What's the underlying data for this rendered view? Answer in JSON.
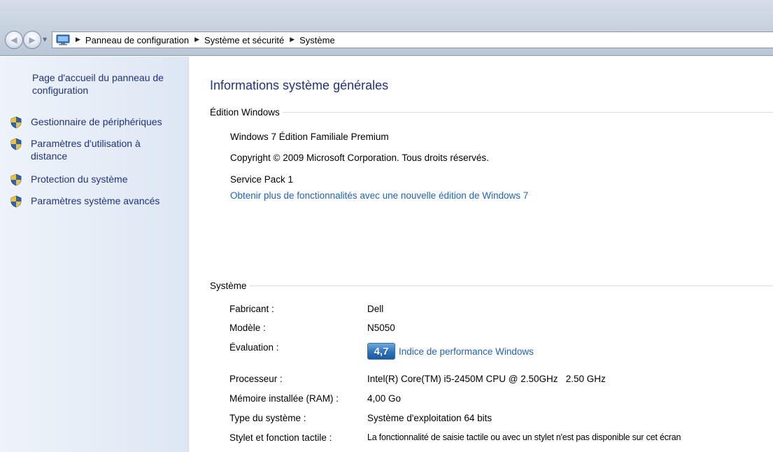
{
  "breadcrumb": {
    "items": [
      "Panneau de configuration",
      "Système et sécurité",
      "Système"
    ]
  },
  "sidebar": {
    "home_link": "Page d'accueil du panneau de configuration",
    "tasks": [
      {
        "label": "Gestionnaire de périphériques",
        "icon": "shield-icon"
      },
      {
        "label": "Paramètres d'utilisation à distance",
        "icon": "shield-icon"
      },
      {
        "label": "Protection du système",
        "icon": "shield-icon"
      },
      {
        "label": "Paramètres système avancés",
        "icon": "shield-icon"
      }
    ]
  },
  "main": {
    "title": "Informations système générales",
    "edition": {
      "header": "Édition Windows",
      "name": "Windows 7 Édition Familiale Premium",
      "copyright": "Copyright © 2009 Microsoft Corporation. Tous droits réservés.",
      "service_pack": "Service Pack 1",
      "upgrade_link": "Obtenir plus de fonctionnalités avec une nouvelle édition de Windows 7"
    },
    "system": {
      "header": "Système",
      "manufacturer_label": "Fabricant :",
      "manufacturer": "Dell",
      "model_label": "Modèle :",
      "model": "N5050",
      "rating_label": "Évaluation :",
      "rating_score": "4,7",
      "rating_link": "Indice de performance Windows",
      "processor_label": "Processeur :",
      "processor": "Intel(R) Core(TM) i5-2450M CPU @ 2.50GHz   2.50 GHz",
      "ram_label": "Mémoire installée (RAM) :",
      "ram": "4,00 Go",
      "type_label": "Type du système :",
      "type": "Système d'exploitation 64 bits",
      "pen_label": "Stylet et fonction tactile :",
      "pen": "La fonctionnalité de saisie tactile ou avec un stylet n'est pas disponible sur cet écran"
    }
  },
  "colors": {
    "link": "#1d62c4",
    "heading": "#1e3287",
    "sidebar_bg": "#dde7f3",
    "chrome_bg": "#c9d3e0"
  }
}
